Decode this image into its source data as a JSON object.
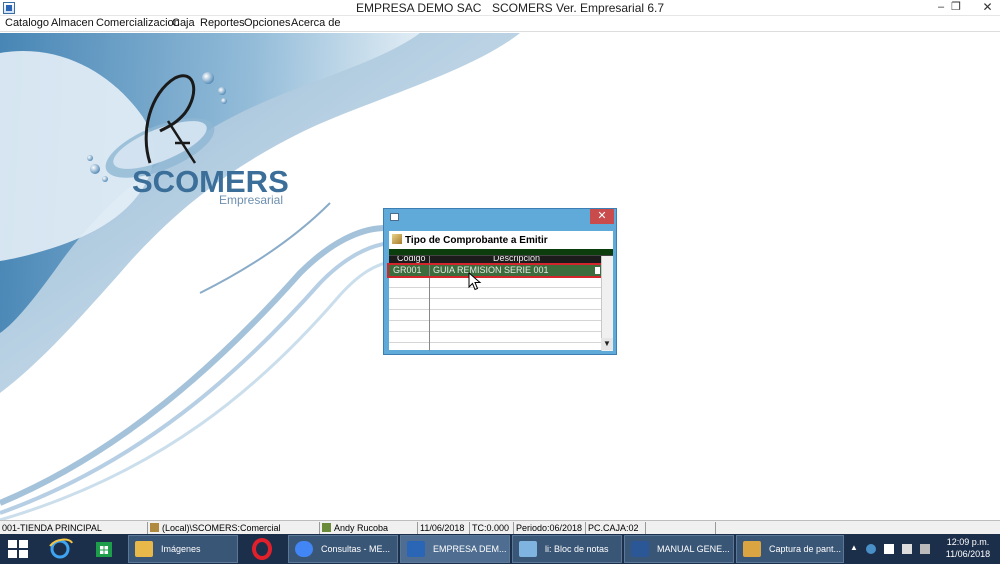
{
  "window": {
    "title_company": "EMPRESA DEMO SAC",
    "title_app": "SCOMERS Ver. Empresarial  6.7",
    "minimize": "–",
    "maximize": "❐",
    "close": "✕"
  },
  "menu": [
    "Catalogo",
    "Almacen",
    "Comercializacion",
    "Caja",
    "Reportes",
    "Opciones",
    "Acerca de"
  ],
  "logo": {
    "brand": "SCOMERS",
    "edition": "Empresarial"
  },
  "dialog": {
    "caption": "Tipo de Comprobante a Emitir",
    "close": "✕",
    "columns": {
      "code": "Código",
      "description": "Descripción"
    },
    "rows": [
      {
        "code": "GR001",
        "description": "GUIA REMISION SERIE 001",
        "selected": true
      }
    ],
    "scroll_down": "▼"
  },
  "statusbar": {
    "store": "001-TIENDA PRINCIPAL",
    "database": "(Local)\\SCOMERS:Comercial",
    "user": "Andy Rucoba",
    "date": "11/06/2018",
    "exchange_rate": "TC:0.000",
    "period": "Periodo:06/2018",
    "register": "PC.CAJA:02"
  },
  "taskbar": {
    "buttons": [
      {
        "label": "Imágenes",
        "icon": "folder-icon",
        "color": "#e8b84a"
      },
      {
        "label": "Consultas - ME...",
        "icon": "chrome-icon",
        "color": "#4285f4"
      },
      {
        "label": "EMPRESA DEM...",
        "icon": "scomers-app-icon",
        "color": "#2a65b6"
      },
      {
        "label": "li: Bloc de notas",
        "icon": "notepad-icon",
        "color": "#7fb3e0"
      },
      {
        "label": "MANUAL GENE...",
        "icon": "word-icon",
        "color": "#2b5797"
      },
      {
        "label": "Captura de pant...",
        "icon": "paint-icon",
        "color": "#d9a441"
      }
    ],
    "clock_time": "12:09 p.m.",
    "clock_date": "11/06/2018"
  },
  "colors": {
    "dialog_frame": "#5faad9",
    "selected_row": "#3d6d3d",
    "highlight": "#d4242c",
    "taskbar": "#1c2f4a"
  }
}
